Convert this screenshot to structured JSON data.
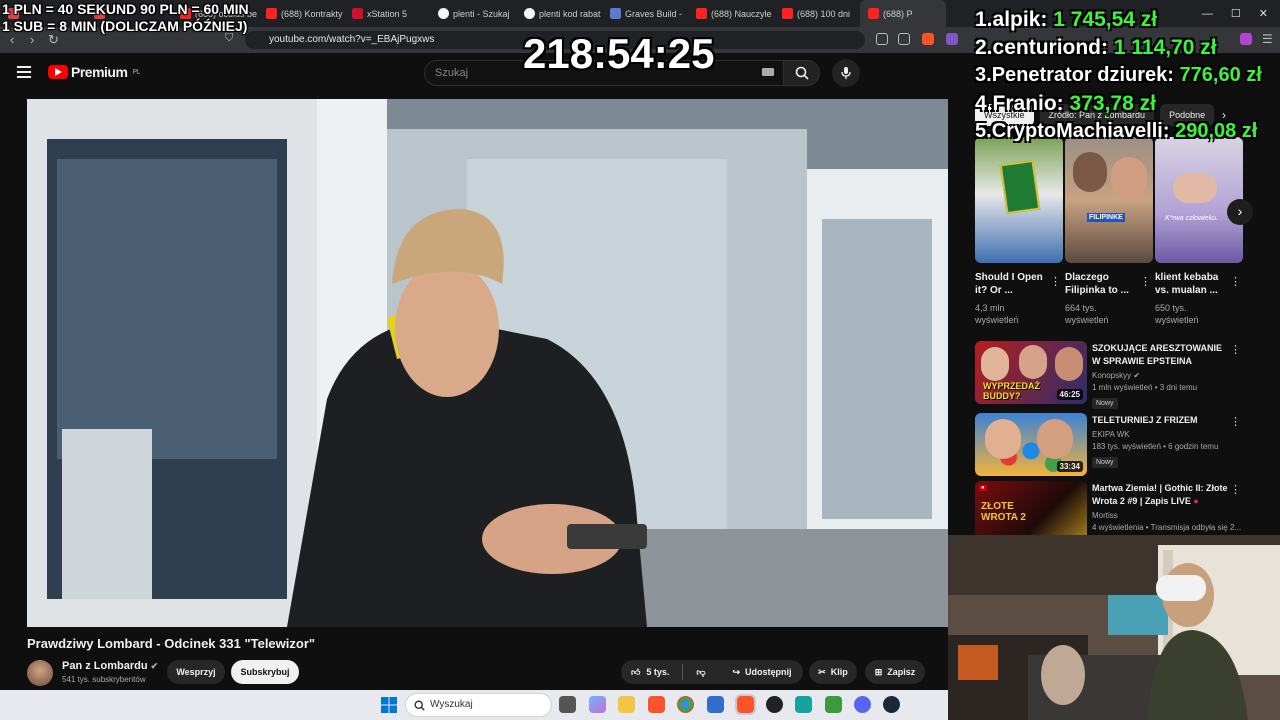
{
  "browser": {
    "tabs": [
      {
        "label": "",
        "color": "#e04444"
      },
      {
        "label": "",
        "color": "#e04444"
      },
      {
        "label": "(688) oculus be",
        "color": "#ff2222"
      },
      {
        "label": "(688) Kontrakty",
        "color": "#ff2222"
      },
      {
        "label": "xStation 5",
        "color": "#d0102c"
      },
      {
        "label": "plenti - Szukaj",
        "color": "#f4f4f4"
      },
      {
        "label": "plenti kod rabat",
        "color": "#f4f4f4"
      },
      {
        "label": "Graves Build -",
        "color": "#5a7bd0"
      },
      {
        "label": "(688) Nauczyle",
        "color": "#ff2222"
      },
      {
        "label": "(688) 100 dni",
        "color": "#ff2222"
      },
      {
        "label": "(688) P",
        "color": "#ff2222"
      }
    ],
    "url": "youtube.com/watch?v=_EBAjPugxws"
  },
  "overlay": {
    "donation_line1": "1 PLN = 40 SEKUND 90 PLN = 60 MIN",
    "donation_line2": "1 SUB = 8 MIN (DOLICZAM PÓŹNIEJ)",
    "timer": "218:54:25"
  },
  "leaderboard": [
    {
      "rank": "1.",
      "name": "alpik:",
      "amount": "1 745,54 zł"
    },
    {
      "rank": "2.",
      "name": "centuriond:",
      "amount": "1 114,70 zł"
    },
    {
      "rank": "3.",
      "name": "Penetrator dziurek:",
      "amount": "776,60 zł"
    },
    {
      "rank": "4.",
      "name": "Franio:",
      "amount": "373,78 zł"
    },
    {
      "rank": "5.",
      "name": "CryptoMachiavelli:",
      "amount": "290,08 zł"
    }
  ],
  "youtube": {
    "logo_text": "Premium",
    "logo_region": "PL",
    "search_placeholder": "Szukaj",
    "video": {
      "title": "Prawdziwy Lombard - Odcinek 331 \"Telewizor\"",
      "channel": "Pan z Lombardu",
      "subscribers": "541 tys. subskrybentów",
      "support_label": "Wesprzyj",
      "subscribe_label": "Subskrybuj",
      "likes": "5 tys.",
      "share_label": "Udostępnij",
      "clip_label": "Klip",
      "save_label": "Zapisz"
    },
    "chips": [
      "Wszystkie",
      "Źródło: Pan z Lombardu",
      "Podobne"
    ],
    "shorts": [
      {
        "title": "Should I Open it? Or ...",
        "views": "4,3 mln wyświetleń"
      },
      {
        "title": "Dlaczego Filipinka to ...",
        "views": "664 tys. wyświetleń",
        "thumb_caption": "FILIPINKE"
      },
      {
        "title": "klient kebaba vs. mualan ...",
        "views": "650 tys. wyświetleń",
        "thumb_caption": "K*rwa człowieku."
      }
    ],
    "recommended": [
      {
        "title": "SZOKUJĄCE ARESZTOWANIE W SPRAWIE EPSTEINA (BUDDA, ...",
        "channel": "Konopskyy",
        "meta": "1 mln wyświetleń • 3 dni temu",
        "badge": "Nowy",
        "duration": "46:25",
        "thumb_text": "WYPRZEDAŻ BUDDY?"
      },
      {
        "title": "TELETURNIEJ Z FRIZEM",
        "channel": "EKIPA WK",
        "meta": "183 tys. wyświetleń • 6 godzin temu",
        "badge": "Nowy",
        "duration": "33:34",
        "thumb_text": ""
      },
      {
        "title": "Martwa Ziemia! | Gothic II: Złote Wrota 2 #9 | Zapis LIVE",
        "channel": "Mortiss",
        "meta": "4 wyświetlenia • Transmisja odbyła się 2...",
        "badge": "",
        "duration": "",
        "thumb_text": "ZŁOTE WROTA 2"
      }
    ]
  },
  "taskbar": {
    "search_placeholder": "Wyszukaj"
  }
}
